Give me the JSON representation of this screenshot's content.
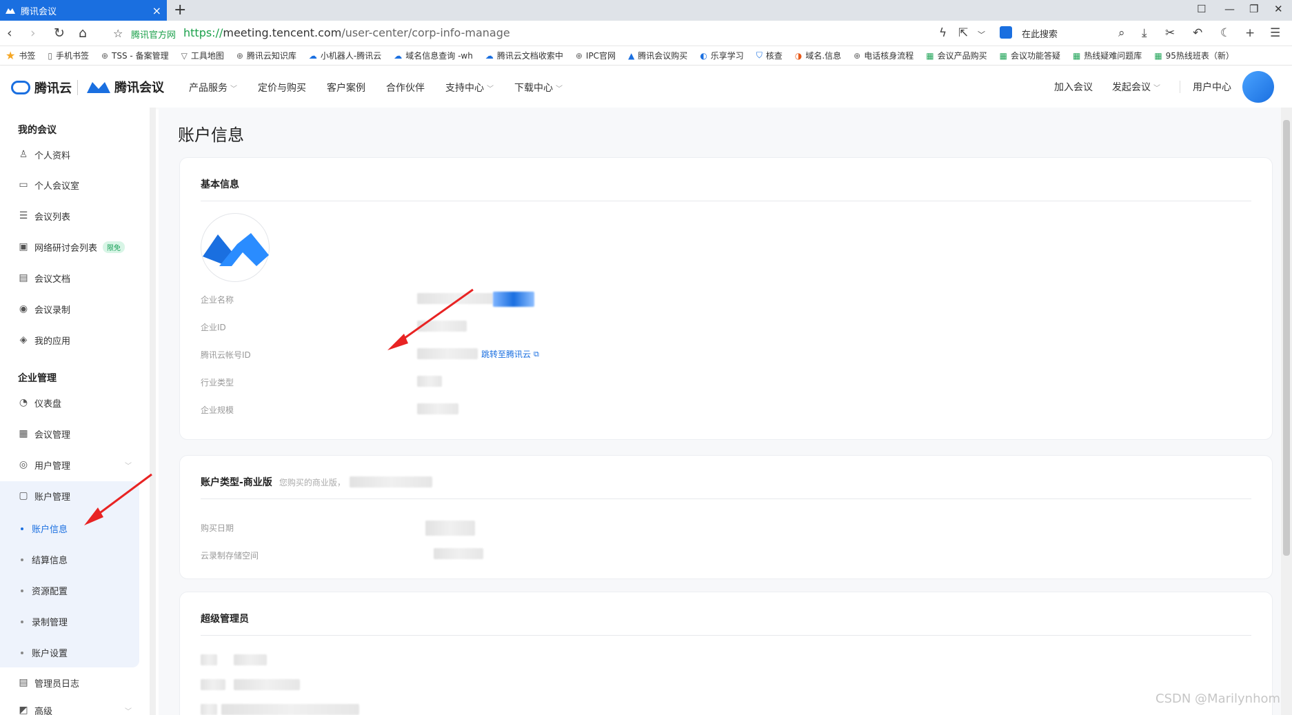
{
  "browser": {
    "tab_title": "腾讯会议",
    "tab_close": "×",
    "new_tab": "+",
    "url_official_label": "腾讯官方网",
    "url_scheme": "https://",
    "url_host": "meeting.tencent.com",
    "url_path": "/user-center/corp-info-manage",
    "search_placeholder": "在此搜索",
    "bookmarks": [
      "书签",
      "手机书签",
      "TSS - 备案管理",
      "工具地图",
      "腾讯云知识库",
      "小机器人-腾讯云",
      "域名信息查询 -wh",
      "腾讯云文档收索中",
      "IPC官网",
      "腾讯会议购买",
      "乐享学习",
      "核查",
      "域名.信息",
      "电话核身流程",
      "会议产品购买",
      "会议功能答疑",
      "热线疑难问题库",
      "95热线班表（新）"
    ]
  },
  "header": {
    "brand_cloud": "腾讯云",
    "brand_meeting": "腾讯会议",
    "nav": [
      {
        "label": "产品服务",
        "chevron": "﹀"
      },
      {
        "label": "定价与购买",
        "chevron": ""
      },
      {
        "label": "客户案例",
        "chevron": ""
      },
      {
        "label": "合作伙伴",
        "chevron": ""
      },
      {
        "label": "支持中心",
        "chevron": "﹀"
      },
      {
        "label": "下载中心",
        "chevron": "﹀"
      }
    ],
    "join_meeting": "加入会议",
    "start_meeting": "发起会议",
    "start_chevron": "﹀",
    "user_center": "用户中心"
  },
  "sidebar": {
    "group_my": "我的会议",
    "my_items": [
      {
        "label": "个人资料",
        "icon": "user-icon",
        "glyph": "♙"
      },
      {
        "label": "个人会议室",
        "icon": "meeting-room-icon",
        "glyph": "▭"
      },
      {
        "label": "会议列表",
        "icon": "list-icon",
        "glyph": "☰"
      },
      {
        "label": "网络研讨会列表",
        "icon": "webinar-icon",
        "glyph": "▣"
      },
      {
        "label": "会议文档",
        "icon": "document-icon",
        "glyph": "▤"
      },
      {
        "label": "会议录制",
        "icon": "record-icon",
        "glyph": "◉"
      },
      {
        "label": "我的应用",
        "icon": "apps-icon",
        "glyph": "◈"
      }
    ],
    "webinar_badge": "限免",
    "group_corp": "企业管理",
    "corp_items": [
      {
        "label": "仪表盘",
        "icon": "dashboard-icon",
        "glyph": "◔"
      },
      {
        "label": "会议管理",
        "icon": "grid-icon",
        "glyph": "▦"
      },
      {
        "label": "用户管理",
        "icon": "user-manage-icon",
        "glyph": "◎"
      },
      {
        "label": "账户管理",
        "icon": "account-icon",
        "glyph": "▢"
      }
    ],
    "user_manage_chevron": "﹀",
    "account_sub": [
      "账户信息",
      "结算信息",
      "资源配置",
      "录制管理",
      "账户设置"
    ],
    "admin_log": "管理员日志",
    "advanced": "高级",
    "advanced_chevron": "﹀"
  },
  "main": {
    "page_title": "账户信息",
    "basic": {
      "title": "基本信息",
      "labels": [
        "企业名称",
        "企业ID",
        "腾讯云帐号ID",
        "行业类型",
        "企业规模"
      ],
      "jump_link": "跳转至腾讯云"
    },
    "type": {
      "title": "账户类型-商业版",
      "note": "您购买的商业版，",
      "labels": [
        "购买日期",
        "云录制存储空间"
      ]
    },
    "admin": {
      "title": "超级管理员"
    }
  },
  "watermark": "CSDN @Marilynhom",
  "colors": {
    "accent": "#1a6fe0",
    "arrow": "#e82323",
    "badge": "#18a058"
  }
}
